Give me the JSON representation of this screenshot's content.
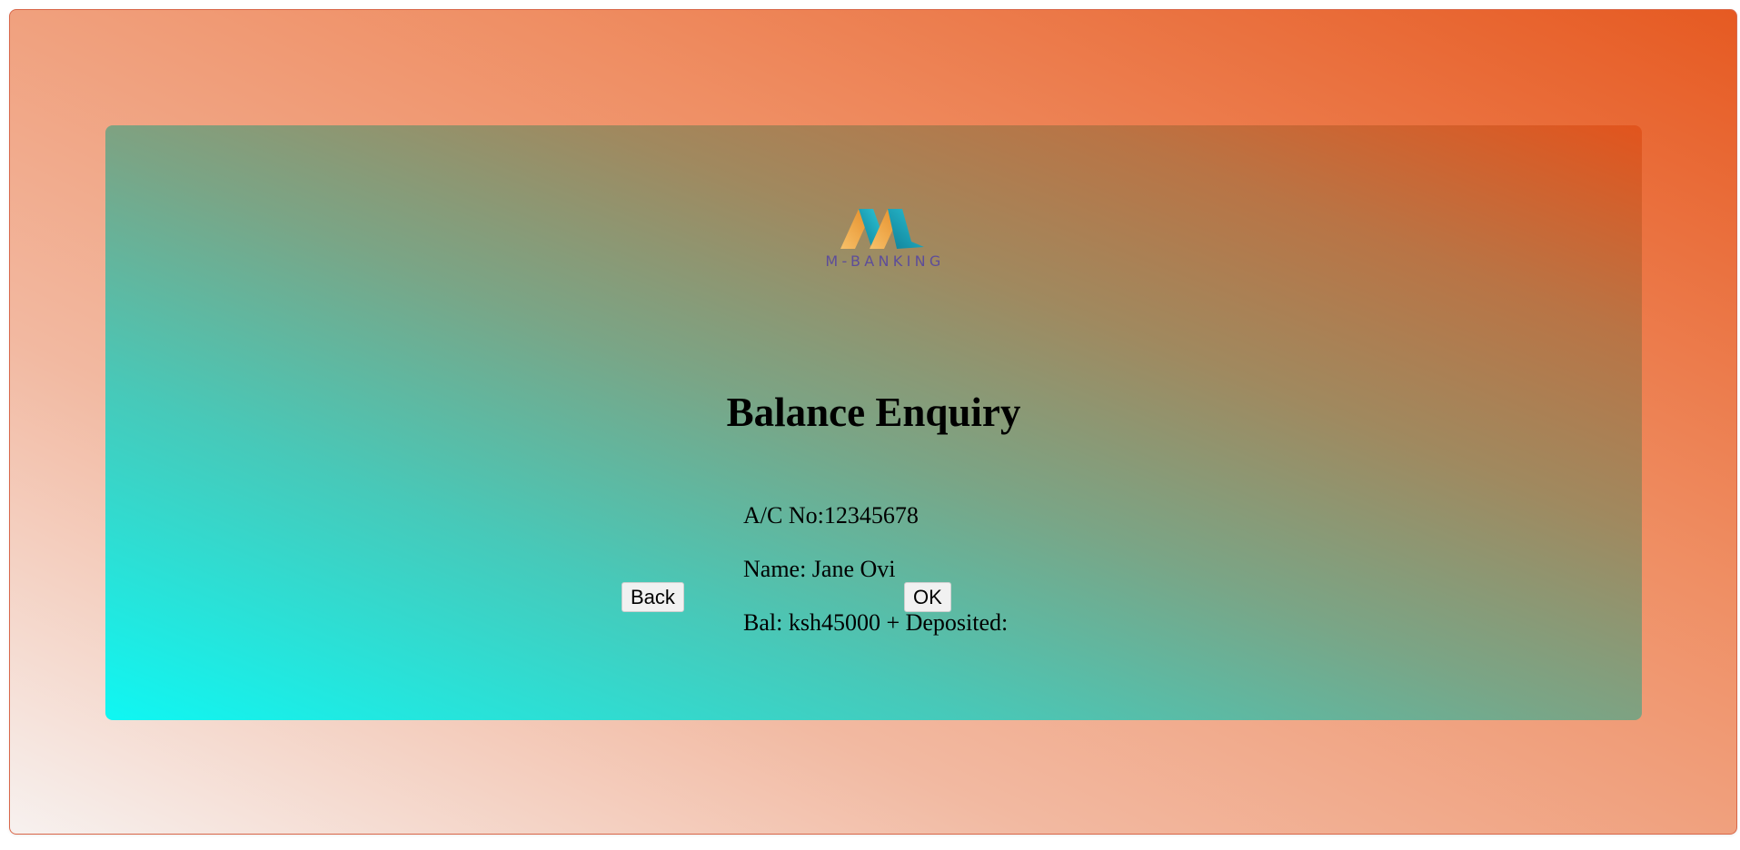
{
  "logo": {
    "text": "M-BANKING",
    "icon": "m-banking-logo-icon",
    "colors": {
      "gold": "#f0a23a",
      "teal": "#1aa9bf",
      "text": "#5d4d9a"
    }
  },
  "page": {
    "title": "Balance Enquiry"
  },
  "account": {
    "acc_line": "A/C No:12345678",
    "name_line": "Name: Jane Ovi",
    "balance_line": "Bal: ksh45000 + Deposited:"
  },
  "buttons": {
    "back_label": "Back",
    "ok_label": "OK"
  },
  "colors": {
    "outer_gradient": [
      "#f7f1ef",
      "#f2b9a1",
      "#ef8e63",
      "#e65a22"
    ],
    "panel_gradient": [
      "#0ff7f3",
      "#47c9b9",
      "#7aa586",
      "#a0895f",
      "#b97445",
      "#e2541d"
    ]
  }
}
